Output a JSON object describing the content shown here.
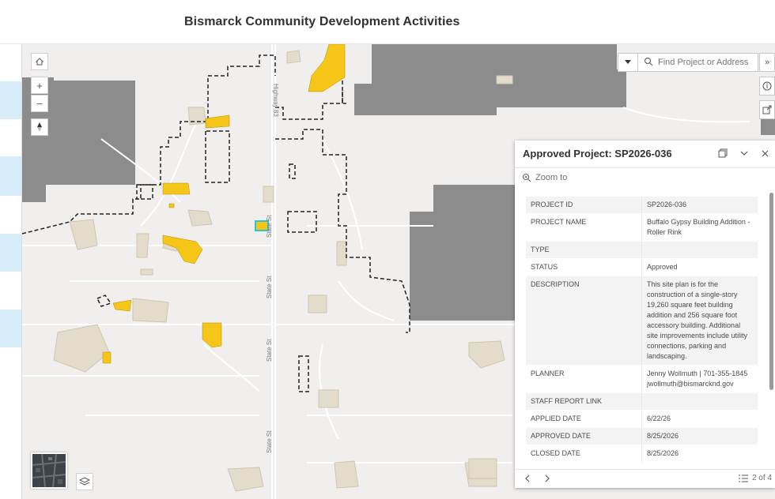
{
  "header": {
    "title": "Bismarck Community Development Activities"
  },
  "map": {
    "road_labels": [
      "Highway 83",
      "State St",
      "State St",
      "State St",
      "State St"
    ],
    "colors": {
      "background": "#f0efed",
      "highlight": "#f5c518",
      "parcel": "#e3dccb",
      "city_limits": "#ebebeb",
      "boundary": "#222222",
      "selected": "#26c6da"
    }
  },
  "controls": {
    "home": "home-icon",
    "zoom_in": "+",
    "zoom_out": "−",
    "compass": "compass-icon",
    "layers": "layers-icon"
  },
  "search": {
    "placeholder": "Find Project or Address",
    "expand": "»"
  },
  "popup": {
    "title": "Approved Project: SP2026-036",
    "zoom_to": "Zoom to",
    "fields": [
      {
        "key": "PROJECT ID",
        "value": "SP2026-036"
      },
      {
        "key": "PROJECT NAME",
        "value": "Buffalo Gypsy Building Addition - Roller Rink"
      },
      {
        "key": "TYPE",
        "value": ""
      },
      {
        "key": "STATUS",
        "value": "Approved"
      },
      {
        "key": "DESCRIPTION",
        "value": "This site plan is for the construction of a single-story 19,260 square feet building addition and 256 square foot accessory building. Additional site improvements include utility connections, parking and landscaping."
      },
      {
        "key": "PLANNER",
        "value": "Jenny Wollmuth | 701-355-1845 jwollmuth@bismarcknd.gov"
      },
      {
        "key": "STAFF REPORT LINK",
        "value": ""
      },
      {
        "key": "APPLIED DATE",
        "value": "6/22/26"
      },
      {
        "key": "APPROVED DATE",
        "value": "8/25/2026"
      },
      {
        "key": "CLOSED DATE",
        "value": "8/25/2026"
      }
    ],
    "pager": "2 of 4"
  }
}
